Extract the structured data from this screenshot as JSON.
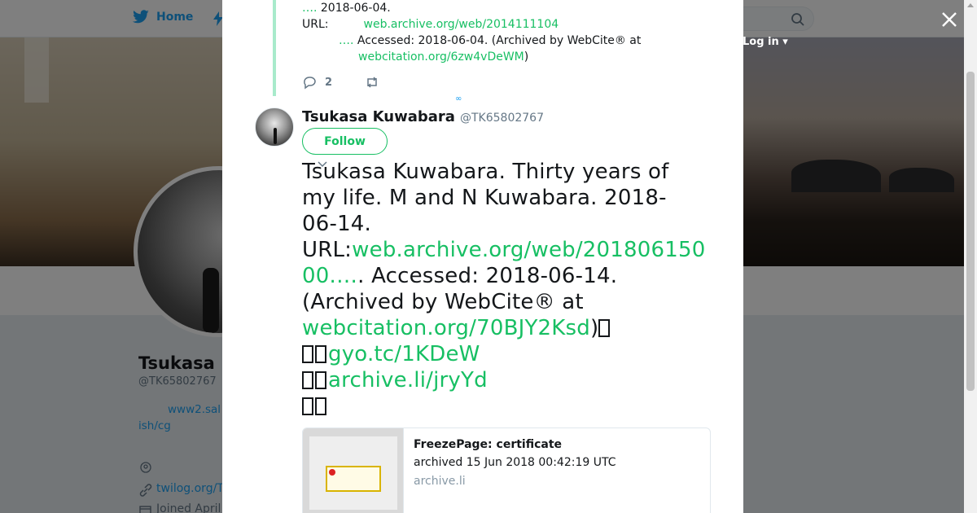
{
  "background": {
    "topbar": {
      "home_label": "Home",
      "login_label": "Log in"
    },
    "profile": {
      "name": "Tsukasa",
      "handle": "@TK65802767",
      "bio_line1": "www2.sal",
      "bio_line2": "ish/cg",
      "link": "twilog.org/T",
      "joined": "Joined April"
    }
  },
  "modal": {
    "previous_tweet": {
      "line1_ellipsis": "….",
      "line1_text": " 2018-06-04.",
      "line2_label": "URL:",
      "line2_link": "web.archive.org/web/2014111104",
      "line3_ellipsis": "….",
      "line3_text": " Accessed: 2018-06-04. (Archived by WebCite® at",
      "line4_link": "webcitation.org/6zw4vDeWM",
      "line4_close": ")",
      "reply_count": "2"
    },
    "tweet": {
      "fullname": "Tsukasa Kuwabara",
      "username": "@TK65802767",
      "follow_label": "Follow",
      "text": {
        "line1": "Tsukasa Kuwabara. Thirty years of",
        "line2": "my life. M and N  Kuwabara. 2018-",
        "line3": "06-14.",
        "line4_label": "URL:",
        "line4_link": "web.archive.org/web/201806150",
        "line5_link": "00.…",
        "line5_text": ".  Accessed: 2018-06-14.",
        "line6": "(Archived by WebCite® at",
        "line7_link": "webcitation.org/70BJY2Ksd",
        "line7_close": ")",
        "line8_link": "gyo.tc/1KDeW",
        "line9_link": "archive.li/jryYd"
      },
      "card": {
        "title": "FreezePage: certificate",
        "description": "archived 15 Jun 2018 00:42:19 UTC",
        "domain": "archive.li"
      }
    }
  },
  "colors": {
    "link_green": "#17bf63",
    "link_blue": "#1da1f2",
    "thread_line": "#a8eacb"
  },
  "icons": [
    "twitter-bird-icon",
    "moments-icon",
    "search-icon",
    "close-icon",
    "reply-icon",
    "retweet-icon",
    "location-icon",
    "link-icon",
    "calendar-icon",
    "caret-down-icon"
  ]
}
